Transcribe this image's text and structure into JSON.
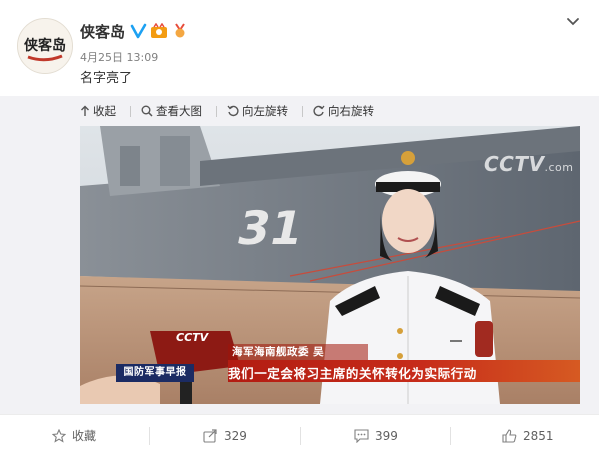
{
  "post": {
    "author": "侠客岛",
    "avatar_text": "侠客岛",
    "timestamp": "4月25日 13:09",
    "text": "名字亮了"
  },
  "media_toolbar": {
    "collapse": "收起",
    "view_large": "查看大图",
    "rotate_left": "向左旋转",
    "rotate_right": "向右旋转"
  },
  "photo": {
    "hull_number": "31",
    "watermark": "CCTV",
    "watermark_suffix": ".com",
    "mic_logo": "CCTV",
    "program_tag": "国防军事早报",
    "caption_name": "海军海南舰政委 吴",
    "caption_quote": "我们一定会将习主席的关怀转化为实际行动"
  },
  "actions": {
    "favorite": "收藏",
    "repost": "329",
    "comment": "399",
    "like": "2851"
  },
  "colors": {
    "verified_blue": "#1da1f2",
    "caption_red": "#c72c1a",
    "program_tag_navy": "#1b2b63"
  },
  "icons": [
    "chevron-down-icon",
    "verified-icon",
    "badge-icon",
    "collapse-icon",
    "zoom-icon",
    "rotate-left-icon",
    "rotate-right-icon",
    "star-icon",
    "repost-icon",
    "comment-icon",
    "like-icon"
  ]
}
